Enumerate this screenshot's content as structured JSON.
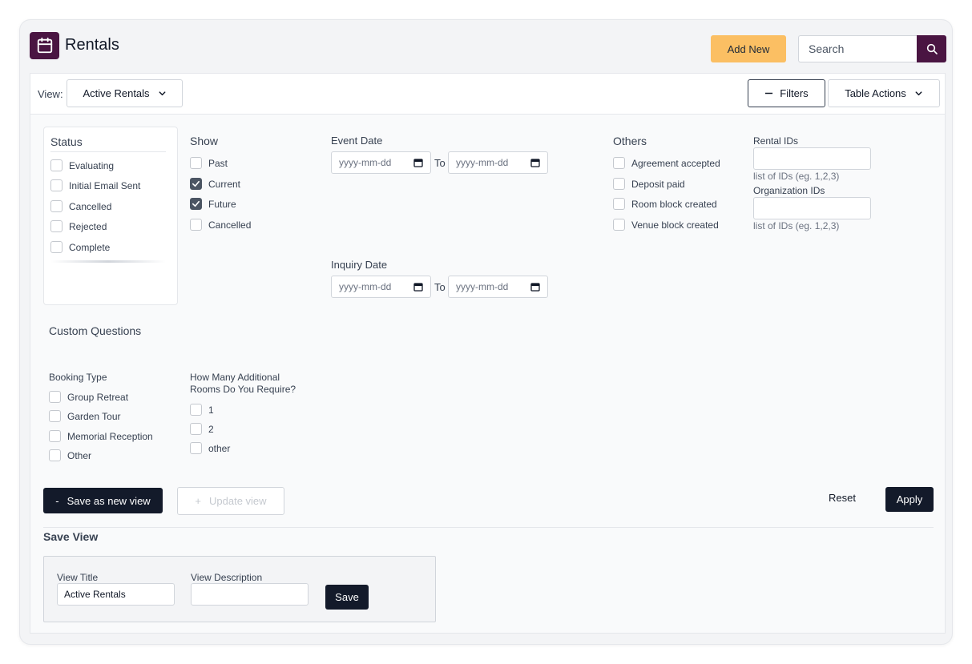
{
  "header": {
    "title": "Rentals",
    "icon": "calendar-icon",
    "add_new_label": "Add New",
    "search_placeholder": "Search",
    "brand_color": "#4a1542",
    "accent_color": "#fbbf63"
  },
  "toolbar": {
    "view_label": "View:",
    "view_selected": "Active Rentals",
    "filters_label": "Filters",
    "table_actions_label": "Table Actions"
  },
  "status": {
    "title": "Status",
    "items": [
      {
        "label": "Evaluating",
        "checked": false
      },
      {
        "label": "Initial Email Sent",
        "checked": false
      },
      {
        "label": "Cancelled",
        "checked": false
      },
      {
        "label": "Rejected",
        "checked": false
      },
      {
        "label": "Complete",
        "checked": false
      }
    ]
  },
  "show": {
    "title": "Show",
    "items": [
      {
        "label": "Past",
        "checked": false
      },
      {
        "label": "Current",
        "checked": true
      },
      {
        "label": "Future",
        "checked": true
      },
      {
        "label": "Cancelled",
        "checked": false
      }
    ]
  },
  "event_date": {
    "title": "Event Date",
    "from_placeholder": "yyyy-mm-dd",
    "to_label": "To",
    "to_placeholder": "yyyy-mm-dd"
  },
  "inquiry_date": {
    "title": "Inquiry Date",
    "from_placeholder": "yyyy-mm-dd",
    "to_label": "To",
    "to_placeholder": "yyyy-mm-dd"
  },
  "others": {
    "title": "Others",
    "items": [
      {
        "label": "Agreement accepted",
        "checked": false
      },
      {
        "label": "Deposit paid",
        "checked": false
      },
      {
        "label": "Room block created",
        "checked": false
      },
      {
        "label": "Venue block created",
        "checked": false
      }
    ]
  },
  "rental_ids": {
    "label": "Rental IDs",
    "hint": "list of IDs (eg. 1,2,3)"
  },
  "organization_ids": {
    "label": "Organization IDs",
    "hint": "list of IDs (eg. 1,2,3)"
  },
  "custom_questions": {
    "title": "Custom Questions",
    "booking_type": {
      "title": "Booking Type",
      "items": [
        {
          "label": "Group Retreat",
          "checked": false
        },
        {
          "label": "Garden Tour",
          "checked": false
        },
        {
          "label": "Memorial Reception",
          "checked": false
        },
        {
          "label": "Other",
          "checked": false
        }
      ]
    },
    "additional_rooms": {
      "title_line1": "How Many Additional",
      "title_line2": "Rooms Do You Require?",
      "items": [
        {
          "label": "1",
          "checked": false
        },
        {
          "label": "2",
          "checked": false
        },
        {
          "label": "other",
          "checked": false
        }
      ]
    }
  },
  "actions": {
    "save_new_prefix": "-",
    "save_new_label": "Save as new view",
    "update_prefix": "+",
    "update_label": "Update view",
    "reset_label": "Reset",
    "apply_label": "Apply"
  },
  "save_view": {
    "title": "Save View",
    "view_title_label": "View Title",
    "view_title_value": "Active Rentals",
    "view_description_label": "View Description",
    "view_description_value": "",
    "save_label": "Save"
  }
}
